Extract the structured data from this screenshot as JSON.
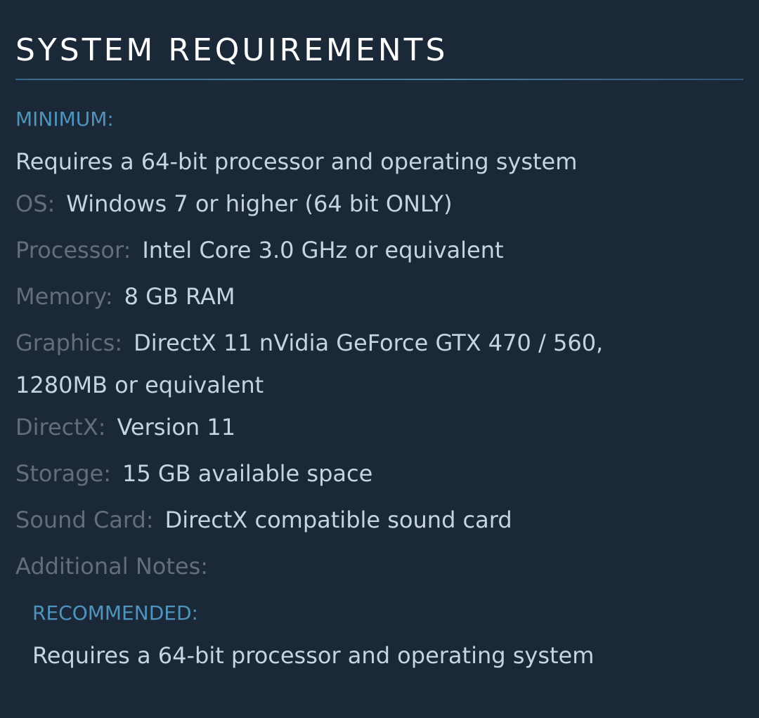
{
  "header": {
    "title": "SYSTEM REQUIREMENTS"
  },
  "minimum": {
    "label": "MINIMUM:",
    "requirement_note": "Requires a 64-bit processor and operating system",
    "os_label": "OS:",
    "os_value": "Windows 7 or higher (64 bit ONLY)",
    "processor_label": "Processor:",
    "processor_value": "Intel Core 3.0 GHz or equivalent",
    "memory_label": "Memory:",
    "memory_value": "8 GB RAM",
    "graphics_label": "Graphics:",
    "graphics_value_line1": "DirectX 11 nVidia GeForce GTX 470 / 560,",
    "graphics_value_line2": "1280MB or equivalent",
    "directx_label": "DirectX:",
    "directx_value": "Version 11",
    "storage_label": "Storage:",
    "storage_value": "15 GB available space",
    "sound_label": "Sound Card:",
    "sound_value": "DirectX compatible sound card",
    "notes_label": "Additional Notes:"
  },
  "recommended": {
    "label": "RECOMMENDED:",
    "requirement_note": "Requires a 64-bit processor and operating system"
  },
  "colors": {
    "background": "#1b2838",
    "section_label": "#4f94bc",
    "spec_label": "#636e77",
    "spec_value": "#c6d4df",
    "title": "#ffffff"
  }
}
